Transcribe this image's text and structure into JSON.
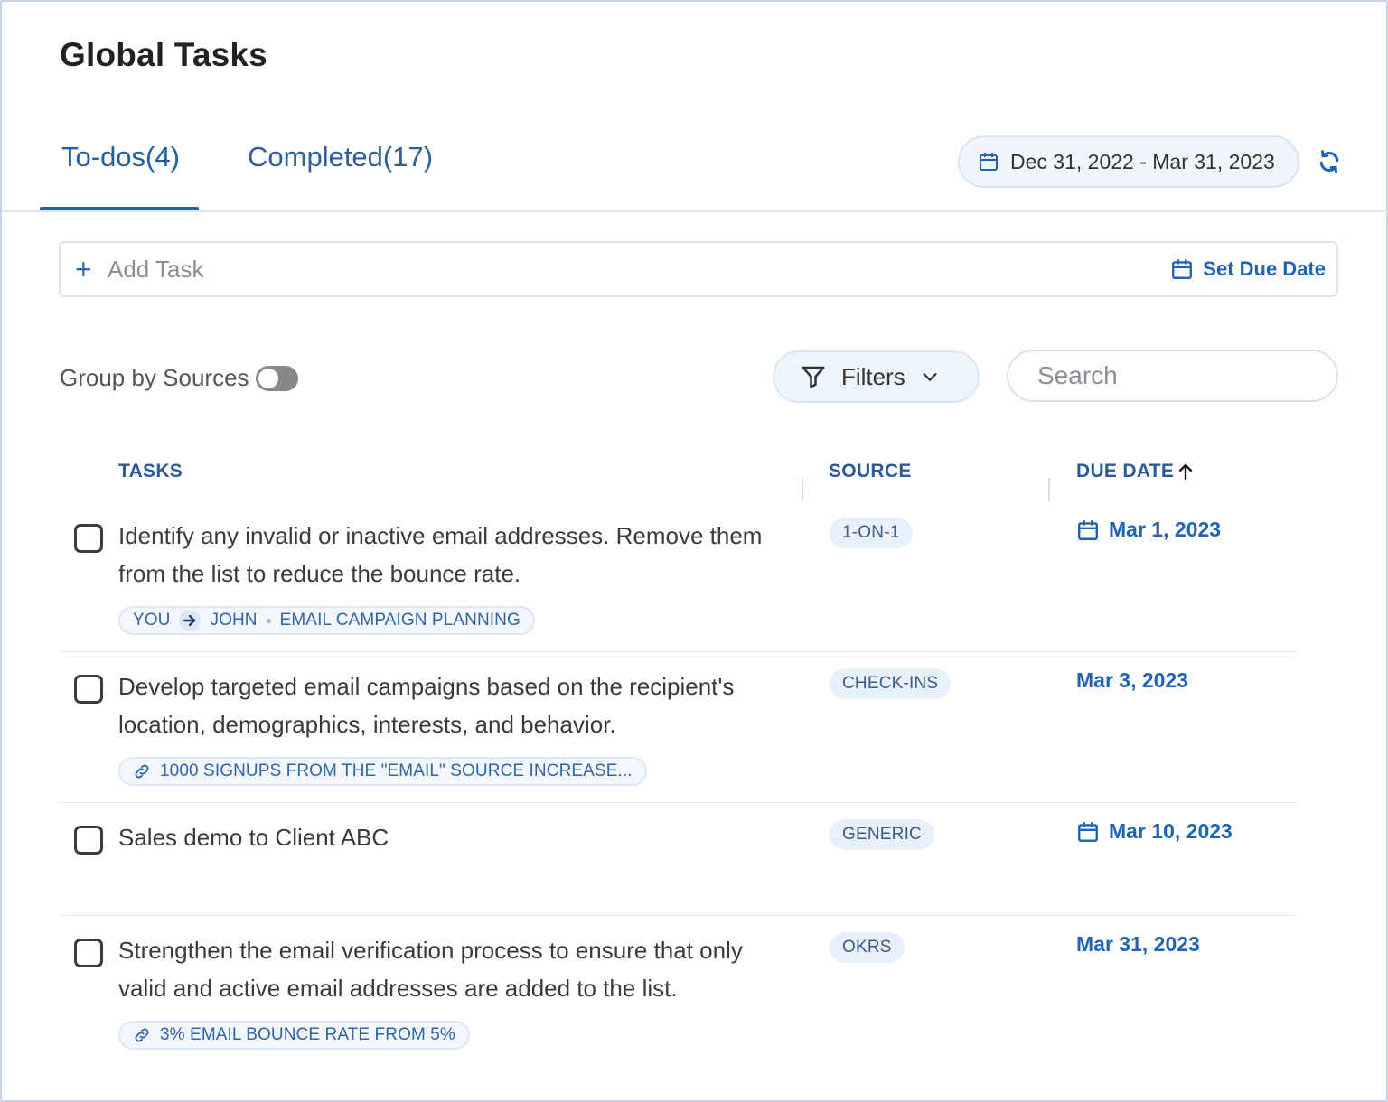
{
  "header": {
    "title": "Global Tasks"
  },
  "tabs": [
    {
      "label": "To-dos(4)",
      "active": true
    },
    {
      "label": "Completed(17)",
      "active": false
    }
  ],
  "date_range": {
    "label": "Dec 31, 2022 - Mar 31, 2023",
    "icon": "calendar-icon"
  },
  "add_task": {
    "placeholder": "Add Task",
    "set_due_label": "Set Due Date"
  },
  "group_by": {
    "label": "Group by Sources",
    "enabled": false
  },
  "filters": {
    "label": "Filters"
  },
  "search": {
    "placeholder": "Search"
  },
  "columns": {
    "tasks": "TASKS",
    "source": "SOURCE",
    "due_date": "DUE DATE"
  },
  "tasks": [
    {
      "text": "Identify any invalid or inactive email addresses. Remove them from the list to reduce the bounce rate.",
      "meta": {
        "from": "YOU",
        "to": "JOHN",
        "context": "EMAIL CAMPAIGN PLANNING"
      },
      "source": "1-ON-1",
      "due": "Mar 1, 2023",
      "due_icon": true
    },
    {
      "text": "Develop targeted email campaigns based on the recipient's location, demographics, interests, and behavior.",
      "link": "1000 SIGNUPS FROM THE \"EMAIL\" SOURCE INCREASE...",
      "source": "CHECK-INS",
      "due": "Mar 3, 2023",
      "due_icon": false
    },
    {
      "text": "Sales demo to Client ABC",
      "source": "GENERIC",
      "due": "Mar 10, 2023",
      "due_icon": true
    },
    {
      "text": "Strengthen the email verification process to ensure that only valid and active email addresses are added to the list.",
      "link": "3% EMAIL BOUNCE RATE FROM 5%",
      "source": "OKRS",
      "due": "Mar 31, 2023",
      "due_icon": false
    }
  ],
  "colors": {
    "accent": "#1f63b3",
    "chip_bg": "#e8f0fb"
  }
}
